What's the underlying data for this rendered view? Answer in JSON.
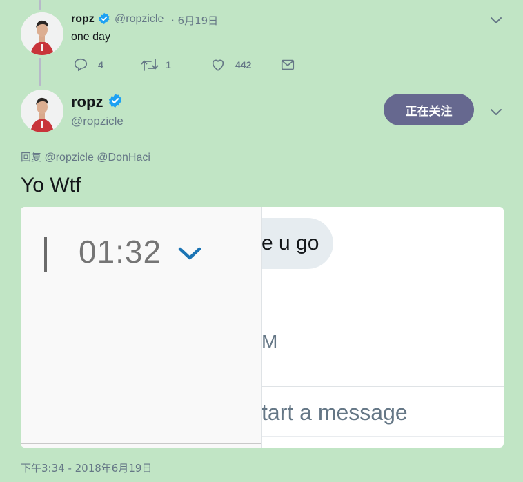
{
  "parent_tweet": {
    "name": "ropz",
    "handle": "@ropzicle",
    "date": "· 6月19日",
    "text": "one day",
    "actions": {
      "reply_count": "4",
      "retweet_count": "1",
      "like_count": "442"
    }
  },
  "main_tweet": {
    "name": "ropz",
    "handle": "@ropzicle",
    "follow_label": "正在关注",
    "reply_prefix": "回复",
    "reply_to": "@ropzicle @DonHaci",
    "text": "Yo Wtf",
    "timestamp": "下午3:34 - 2018年6月19日"
  },
  "media": {
    "timer": "01:32",
    "bubble_text": "e u go",
    "partial_text": "M",
    "compose_placeholder": "tart a message"
  },
  "colors": {
    "background": "#c1e5c5",
    "verified": "#1da1f2",
    "follow_button": "#66688f",
    "muted": "#657786"
  },
  "icons": {
    "verified": "verified-badge-icon",
    "chevron": "chevron-down-icon",
    "reply": "reply-icon",
    "retweet": "retweet-icon",
    "like": "heart-icon",
    "dm": "envelope-icon"
  }
}
